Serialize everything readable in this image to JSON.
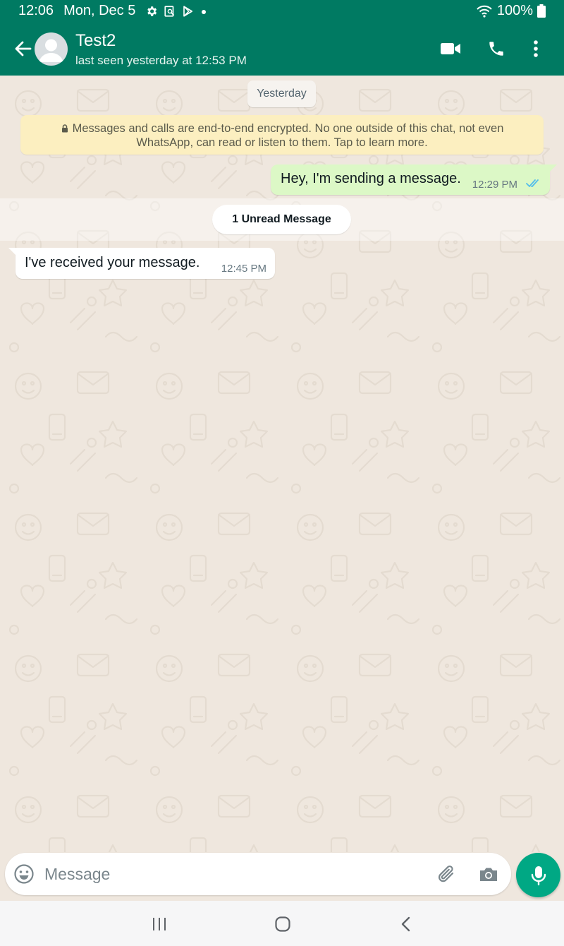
{
  "status_bar": {
    "time": "12:06",
    "date": "Mon, Dec 5",
    "battery": "100%",
    "icons": [
      "settings-icon",
      "screenshot-icon",
      "play-store-icon",
      "notification-dot-icon",
      "wifi-icon",
      "battery-icon"
    ]
  },
  "header": {
    "contact_name": "Test2",
    "last_seen": "last seen yesterday at 12:53 PM",
    "icons": [
      "back-arrow-icon",
      "avatar",
      "video-call-icon",
      "voice-call-icon",
      "more-options-icon"
    ]
  },
  "chat": {
    "date_separator": "Yesterday",
    "encryption_notice": "Messages and calls are end-to-end encrypted. No one outside of this chat, not even WhatsApp, can read or listen to them. Tap to learn more.",
    "messages": [
      {
        "direction": "outgoing",
        "text": "Hey, I'm sending a message.",
        "time": "12:29 PM",
        "status": "read"
      },
      {
        "direction": "incoming",
        "text": "I've received your message.",
        "time": "12:45 PM"
      }
    ],
    "unread_label": "1 Unread Message"
  },
  "composer": {
    "placeholder": "Message",
    "icons": [
      "emoji-icon",
      "attach-icon",
      "camera-icon",
      "mic-icon"
    ]
  },
  "nav_bar": {
    "icons": [
      "recents-icon",
      "home-icon",
      "back-icon"
    ]
  },
  "colors": {
    "header": "#007a62",
    "wallpaper": "#efe7de",
    "outgoing_bubble": "#dcf8c6",
    "incoming_bubble": "#ffffff",
    "encryption_bg": "#fcefc0",
    "read_ticks": "#53bdeb",
    "mic_button": "#00a884"
  }
}
